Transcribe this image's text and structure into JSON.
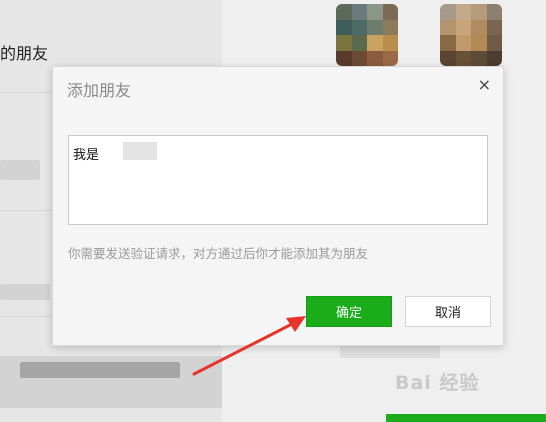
{
  "background": {
    "friends_title": "的朋友"
  },
  "dialog": {
    "title": "添加朋友",
    "close_icon": "×",
    "message_value": "我是",
    "hint": "你需要发送验证请求，对方通过后你才能添加其为朋友",
    "confirm_label": "确定",
    "cancel_label": "取消"
  },
  "colors": {
    "accent": "#1aad19",
    "annotation_arrow": "#e8332b"
  }
}
